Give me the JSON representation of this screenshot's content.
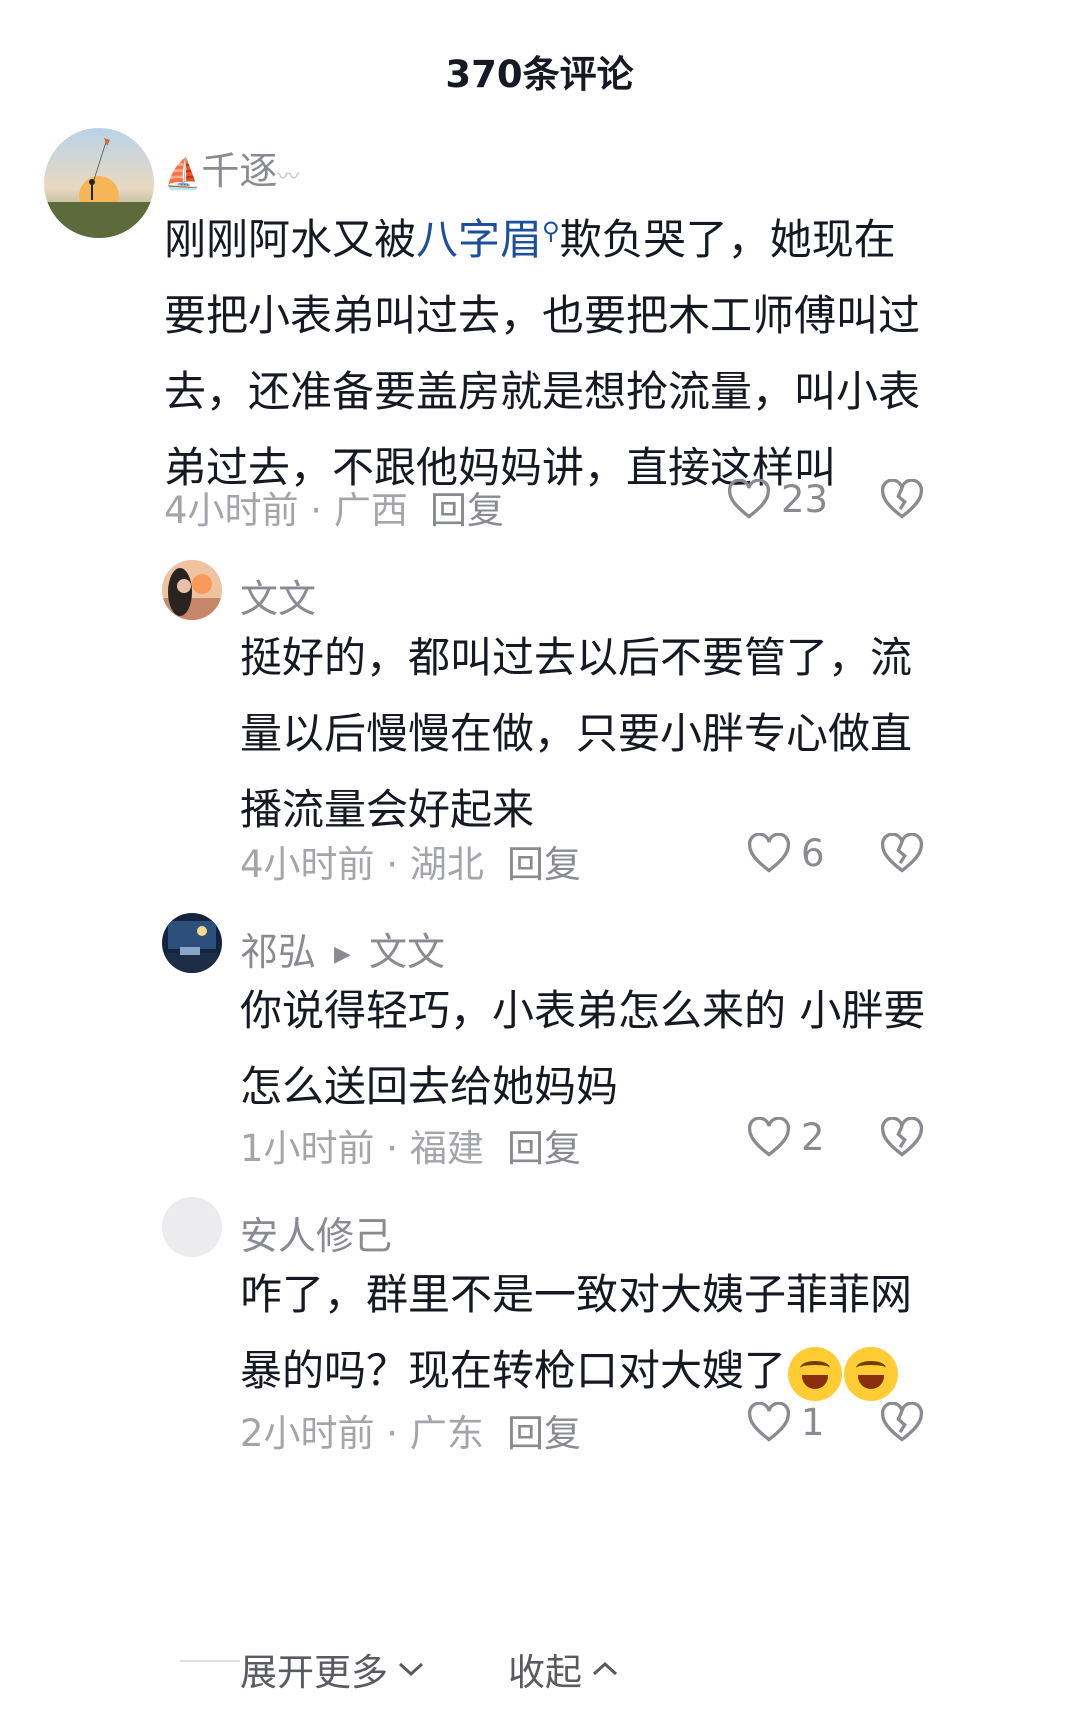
{
  "header": {
    "title": "370条评论"
  },
  "comments": [
    {
      "username": "千逐",
      "text_before": "刚刚阿水又被",
      "link_text": "八字眉",
      "text_after": "欺负哭了，她现在要把小表弟叫过去，也要把木工师傅叫过去，还准备要盖房就是想抢流量，叫小表弟过去，不跟他妈妈讲，直接这样叫",
      "meta": "4小时前 · 广西",
      "reply_label": "回复",
      "likes": "23",
      "avatar_icon": "sunset-kite-avatar"
    },
    {
      "username": "文文",
      "text": "挺好的，都叫过去以后不要管了，流量以后慢慢在做，只要小胖专心做直播流量会好起来",
      "meta": "4小时前 · 湖北",
      "reply_label": "回复",
      "likes": "6",
      "avatar_icon": "girl-sunset-avatar"
    },
    {
      "username": "祁弘",
      "reply_to": "文文",
      "text": "你说得轻巧，小表弟怎么来的 小胖要怎么送回去给她妈妈",
      "meta": "1小时前 · 福建",
      "reply_label": "回复",
      "likes": "2",
      "avatar_icon": "night-room-avatar"
    },
    {
      "username": "安人修己",
      "text": "咋了，群里不是一致对大姨子菲菲网暴的吗？现在转枪口对大嫂了",
      "emoji": [
        "laugh-cry-emoji",
        "laugh-cry-emoji"
      ],
      "meta": "2小时前 · 广东",
      "reply_label": "回复",
      "likes": "1",
      "avatar_icon": "blank-avatar"
    }
  ],
  "footer": {
    "expand_label": "展开更多",
    "collapse_label": "收起"
  },
  "colors": {
    "text": "#161823",
    "meta": "#a4a5aa",
    "link": "#1c4f9c",
    "background": "#ffffff"
  }
}
